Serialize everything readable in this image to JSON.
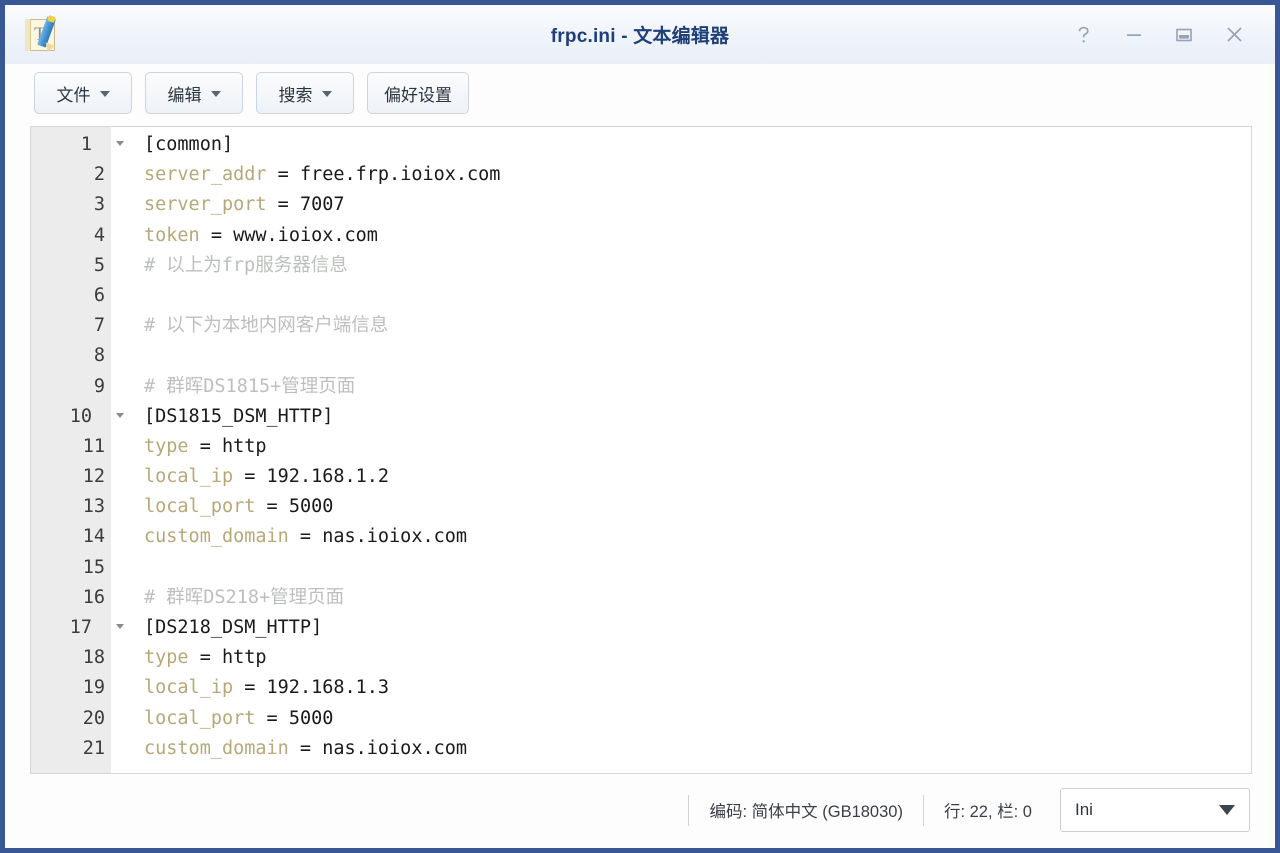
{
  "window": {
    "title": "frpc.ini - 文本编辑器",
    "app_icon": "text-editor-icon",
    "border_color": "#3a5795",
    "title_color": "#1f3f78",
    "controls": [
      {
        "name": "help-button",
        "icon": "question-mark-icon",
        "label": "?"
      },
      {
        "name": "minimize-button",
        "icon": "minimize-icon",
        "label": "—"
      },
      {
        "name": "maximize-button",
        "icon": "maximize-icon",
        "label": "▢"
      },
      {
        "name": "close-button",
        "icon": "close-icon",
        "label": "✕"
      }
    ]
  },
  "toolbar": {
    "buttons": [
      {
        "label": "文件",
        "has_menu": true
      },
      {
        "label": "编辑",
        "has_menu": true
      },
      {
        "label": "搜索",
        "has_menu": true
      },
      {
        "label": "偏好设置",
        "has_menu": false
      }
    ]
  },
  "editor": {
    "colors": {
      "key": "#b7a878",
      "value": "#1a1a1a",
      "comment": "#bcc0bc",
      "gutter_bg": "#ececec",
      "background": "#ffffff"
    },
    "lines": [
      {
        "n": "1",
        "fold": true,
        "tokens": [
          {
            "t": "section",
            "s": "[common]"
          }
        ]
      },
      {
        "n": "2",
        "fold": false,
        "tokens": [
          {
            "t": "key",
            "s": "server_addr"
          },
          {
            "t": "op",
            "s": " = "
          },
          {
            "t": "val",
            "s": "free.frp.ioiox.com"
          }
        ]
      },
      {
        "n": "3",
        "fold": false,
        "tokens": [
          {
            "t": "key",
            "s": "server_port"
          },
          {
            "t": "op",
            "s": " = "
          },
          {
            "t": "val",
            "s": "7007"
          }
        ]
      },
      {
        "n": "4",
        "fold": false,
        "tokens": [
          {
            "t": "key",
            "s": "token"
          },
          {
            "t": "op",
            "s": " = "
          },
          {
            "t": "val",
            "s": "www.ioiox.com"
          }
        ]
      },
      {
        "n": "5",
        "fold": false,
        "tokens": [
          {
            "t": "comment",
            "s": "# 以上为frp服务器信息"
          }
        ]
      },
      {
        "n": "6",
        "fold": false,
        "tokens": []
      },
      {
        "n": "7",
        "fold": false,
        "tokens": [
          {
            "t": "comment",
            "s": "# 以下为本地内网客户端信息"
          }
        ]
      },
      {
        "n": "8",
        "fold": false,
        "tokens": []
      },
      {
        "n": "9",
        "fold": false,
        "tokens": [
          {
            "t": "comment",
            "s": "# 群晖DS1815+管理页面"
          }
        ]
      },
      {
        "n": "10",
        "fold": true,
        "tokens": [
          {
            "t": "section",
            "s": "[DS1815_DSM_HTTP]"
          }
        ]
      },
      {
        "n": "11",
        "fold": false,
        "tokens": [
          {
            "t": "key",
            "s": "type"
          },
          {
            "t": "op",
            "s": " = "
          },
          {
            "t": "val",
            "s": "http"
          }
        ]
      },
      {
        "n": "12",
        "fold": false,
        "tokens": [
          {
            "t": "key",
            "s": "local_ip"
          },
          {
            "t": "op",
            "s": " = "
          },
          {
            "t": "val",
            "s": "192.168.1.2"
          }
        ]
      },
      {
        "n": "13",
        "fold": false,
        "tokens": [
          {
            "t": "key",
            "s": "local_port"
          },
          {
            "t": "op",
            "s": " = "
          },
          {
            "t": "val",
            "s": "5000"
          }
        ]
      },
      {
        "n": "14",
        "fold": false,
        "tokens": [
          {
            "t": "key",
            "s": "custom_domain"
          },
          {
            "t": "op",
            "s": " = "
          },
          {
            "t": "val",
            "s": "nas.ioiox.com"
          }
        ]
      },
      {
        "n": "15",
        "fold": false,
        "tokens": []
      },
      {
        "n": "16",
        "fold": false,
        "tokens": [
          {
            "t": "comment",
            "s": "# 群晖DS218+管理页面"
          }
        ]
      },
      {
        "n": "17",
        "fold": true,
        "tokens": [
          {
            "t": "section",
            "s": "[DS218_DSM_HTTP]"
          }
        ]
      },
      {
        "n": "18",
        "fold": false,
        "tokens": [
          {
            "t": "key",
            "s": "type"
          },
          {
            "t": "op",
            "s": " = "
          },
          {
            "t": "val",
            "s": "http"
          }
        ]
      },
      {
        "n": "19",
        "fold": false,
        "tokens": [
          {
            "t": "key",
            "s": "local_ip"
          },
          {
            "t": "op",
            "s": " = "
          },
          {
            "t": "val",
            "s": "192.168.1.3"
          }
        ]
      },
      {
        "n": "20",
        "fold": false,
        "tokens": [
          {
            "t": "key",
            "s": "local_port"
          },
          {
            "t": "op",
            "s": " = "
          },
          {
            "t": "val",
            "s": "5000"
          }
        ]
      },
      {
        "n": "21",
        "fold": false,
        "tokens": [
          {
            "t": "key",
            "s": "custom_domain"
          },
          {
            "t": "op",
            "s": " = "
          },
          {
            "t": "val",
            "s": "nas.ioiox.com"
          }
        ]
      }
    ]
  },
  "statusbar": {
    "encoding": "编码: 简体中文 (GB18030)",
    "cursor": "行: 22, 栏: 0",
    "language": "Ini"
  }
}
